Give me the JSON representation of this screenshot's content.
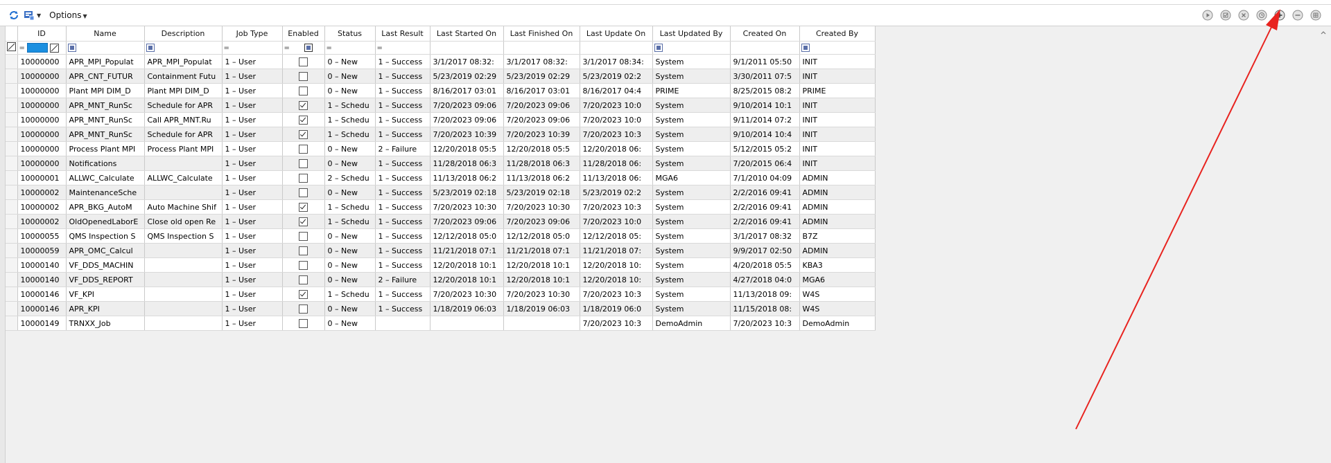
{
  "toolbar": {
    "left_icons": [
      "refresh-icon",
      "layout-icon"
    ],
    "options_label": "Options",
    "right_controls": [
      "play-icon",
      "check-icon",
      "cancel-icon",
      "clock-icon",
      "add-icon",
      "remove-icon",
      "grid-icon"
    ]
  },
  "grid": {
    "columns": [
      "ID",
      "Name",
      "Description",
      "Job Type",
      "Enabled",
      "Status",
      "Last Result",
      "Last Started On",
      "Last Finished On",
      "Last Update On",
      "Last Updated By",
      "Created On",
      "Created By"
    ],
    "filter_eq": "=",
    "rows": [
      {
        "id": "10000000",
        "name": "APR_MPI_Populat",
        "description": "APR_MPI_Populat",
        "job_type": "1 – User",
        "enabled": false,
        "status": "0 – New",
        "last_result": "1 – Success",
        "last_started": "3/1/2017 08:32:",
        "last_finished": "3/1/2017 08:32:",
        "last_update": "3/1/2017 08:34:",
        "updated_by": "System",
        "created_on": "9/1/2011 05:50",
        "created_by": "INIT"
      },
      {
        "id": "10000000",
        "name": "APR_CNT_FUTUR",
        "description": "Containment Futu",
        "job_type": "1 – User",
        "enabled": false,
        "status": "0 – New",
        "last_result": "1 – Success",
        "last_started": "5/23/2019 02:29",
        "last_finished": "5/23/2019 02:29",
        "last_update": "5/23/2019 02:2",
        "updated_by": "System",
        "created_on": "3/30/2011 07:5",
        "created_by": "INIT"
      },
      {
        "id": "10000000",
        "name": "Plant MPI DIM_D",
        "description": "Plant MPI DIM_D",
        "job_type": "1 – User",
        "enabled": false,
        "status": "0 – New",
        "last_result": "1 – Success",
        "last_started": "8/16/2017 03:01",
        "last_finished": "8/16/2017 03:01",
        "last_update": "8/16/2017 04:4",
        "updated_by": "PRIME",
        "created_on": "8/25/2015 08:2",
        "created_by": "PRIME"
      },
      {
        "id": "10000000",
        "name": "APR_MNT_RunSc",
        "description": "Schedule for APR",
        "job_type": "1 – User",
        "enabled": true,
        "status": "1 – Schedu",
        "last_result": "1 – Success",
        "last_started": "7/20/2023 09:06",
        "last_finished": "7/20/2023 09:06",
        "last_update": "7/20/2023 10:0",
        "updated_by": "System",
        "created_on": "9/10/2014 10:1",
        "created_by": "INIT"
      },
      {
        "id": "10000000",
        "name": "APR_MNT_RunSc",
        "description": "Call APR_MNT.Ru",
        "job_type": "1 – User",
        "enabled": true,
        "status": "1 – Schedu",
        "last_result": "1 – Success",
        "last_started": "7/20/2023 09:06",
        "last_finished": "7/20/2023 09:06",
        "last_update": "7/20/2023 10:0",
        "updated_by": "System",
        "created_on": "9/11/2014 07:2",
        "created_by": "INIT"
      },
      {
        "id": "10000000",
        "name": "APR_MNT_RunSc",
        "description": "Schedule for APR",
        "job_type": "1 – User",
        "enabled": true,
        "status": "1 – Schedu",
        "last_result": "1 – Success",
        "last_started": "7/20/2023 10:39",
        "last_finished": "7/20/2023 10:39",
        "last_update": "7/20/2023 10:3",
        "updated_by": "System",
        "created_on": "9/10/2014 10:4",
        "created_by": "INIT"
      },
      {
        "id": "10000000",
        "name": "Process Plant MPI",
        "description": "Process Plant MPI",
        "job_type": "1 – User",
        "enabled": false,
        "status": "0 – New",
        "last_result": "2 – Failure",
        "last_started": "12/20/2018 05:5",
        "last_finished": "12/20/2018 05:5",
        "last_update": "12/20/2018 06:",
        "updated_by": "System",
        "created_on": "5/12/2015 05:2",
        "created_by": "INIT"
      },
      {
        "id": "10000000",
        "name": "Notifications",
        "description": "",
        "job_type": "1 – User",
        "enabled": false,
        "status": "0 – New",
        "last_result": "1 – Success",
        "last_started": "11/28/2018 06:3",
        "last_finished": "11/28/2018 06:3",
        "last_update": "11/28/2018 06:",
        "updated_by": "System",
        "created_on": "7/20/2015 06:4",
        "created_by": "INIT"
      },
      {
        "id": "10000001",
        "name": "ALLWC_Calculate",
        "description": "ALLWC_Calculate",
        "job_type": "1 – User",
        "enabled": false,
        "status": "2 – Schedu",
        "last_result": "1 – Success",
        "last_started": "11/13/2018 06:2",
        "last_finished": "11/13/2018 06:2",
        "last_update": "11/13/2018 06:",
        "updated_by": "MGA6",
        "created_on": "7/1/2010 04:09",
        "created_by": "ADMIN"
      },
      {
        "id": "10000002",
        "name": "MaintenanceSche",
        "description": "",
        "job_type": "1 – User",
        "enabled": false,
        "status": "0 – New",
        "last_result": "1 – Success",
        "last_started": "5/23/2019 02:18",
        "last_finished": "5/23/2019 02:18",
        "last_update": "5/23/2019 02:2",
        "updated_by": "System",
        "created_on": "2/2/2016 09:41",
        "created_by": "ADMIN"
      },
      {
        "id": "10000002",
        "name": "APR_BKG_AutoM",
        "description": "Auto Machine Shif",
        "job_type": "1 – User",
        "enabled": true,
        "status": "1 – Schedu",
        "last_result": "1 – Success",
        "last_started": "7/20/2023 10:30",
        "last_finished": "7/20/2023 10:30",
        "last_update": "7/20/2023 10:3",
        "updated_by": "System",
        "created_on": "2/2/2016 09:41",
        "created_by": "ADMIN"
      },
      {
        "id": "10000002",
        "name": "OldOpenedLaborE",
        "description": "Close old open Re",
        "job_type": "1 – User",
        "enabled": true,
        "status": "1 – Schedu",
        "last_result": "1 – Success",
        "last_started": "7/20/2023 09:06",
        "last_finished": "7/20/2023 09:06",
        "last_update": "7/20/2023 10:0",
        "updated_by": "System",
        "created_on": "2/2/2016 09:41",
        "created_by": "ADMIN"
      },
      {
        "id": "10000055",
        "name": "QMS Inspection S",
        "description": "QMS Inspection S",
        "job_type": "1 – User",
        "enabled": false,
        "status": "0 – New",
        "last_result": "1 – Success",
        "last_started": "12/12/2018 05:0",
        "last_finished": "12/12/2018 05:0",
        "last_update": "12/12/2018 05:",
        "updated_by": "System",
        "created_on": "3/1/2017 08:32",
        "created_by": "B7Z"
      },
      {
        "id": "10000059",
        "name": "APR_OMC_Calcul",
        "description": "",
        "job_type": "1 – User",
        "enabled": false,
        "status": "0 – New",
        "last_result": "1 – Success",
        "last_started": "11/21/2018 07:1",
        "last_finished": "11/21/2018 07:1",
        "last_update": "11/21/2018 07:",
        "updated_by": "System",
        "created_on": "9/9/2017 02:50",
        "created_by": "ADMIN"
      },
      {
        "id": "10000140",
        "name": "VF_DDS_MACHIN",
        "description": "",
        "job_type": "1 – User",
        "enabled": false,
        "status": "0 – New",
        "last_result": "1 – Success",
        "last_started": "12/20/2018 10:1",
        "last_finished": "12/20/2018 10:1",
        "last_update": "12/20/2018 10:",
        "updated_by": "System",
        "created_on": "4/20/2018 05:5",
        "created_by": "KBA3"
      },
      {
        "id": "10000140",
        "name": "VF_DDS_REPORT",
        "description": "",
        "job_type": "1 – User",
        "enabled": false,
        "status": "0 – New",
        "last_result": "2 – Failure",
        "last_started": "12/20/2018 10:1",
        "last_finished": "12/20/2018 10:1",
        "last_update": "12/20/2018 10:",
        "updated_by": "System",
        "created_on": "4/27/2018 04:0",
        "created_by": "MGA6"
      },
      {
        "id": "10000146",
        "name": "VF_KPI",
        "description": "",
        "job_type": "1 – User",
        "enabled": true,
        "status": "1 – Schedu",
        "last_result": "1 – Success",
        "last_started": "7/20/2023 10:30",
        "last_finished": "7/20/2023 10:30",
        "last_update": "7/20/2023 10:3",
        "updated_by": "System",
        "created_on": "11/13/2018 09:",
        "created_by": "W4S"
      },
      {
        "id": "10000146",
        "name": "APR_KPI",
        "description": "",
        "job_type": "1 – User",
        "enabled": false,
        "status": "0 – New",
        "last_result": "1 – Success",
        "last_started": "1/18/2019 06:03",
        "last_finished": "1/18/2019 06:03",
        "last_update": "1/18/2019 06:0",
        "updated_by": "System",
        "created_on": "11/15/2018 08:",
        "created_by": "W4S"
      },
      {
        "id": "10000149",
        "name": "TRNXX_Job",
        "description": "",
        "job_type": "1 – User",
        "enabled": false,
        "status": "0 – New",
        "last_result": "",
        "last_started": "",
        "last_finished": "",
        "last_update": "7/20/2023 10:3",
        "updated_by": "DemoAdmin",
        "created_on": "7/20/2023 10:3",
        "created_by": "DemoAdmin"
      }
    ]
  },
  "annotation": {
    "arrow_color": "#e8231f"
  }
}
